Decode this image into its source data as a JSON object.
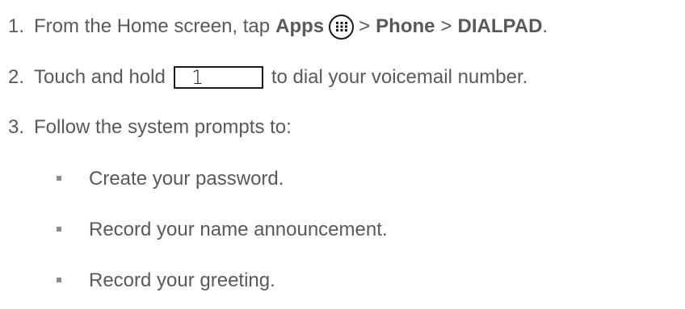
{
  "steps": [
    {
      "number": "1.",
      "pre": "From the Home screen, tap",
      "apps": "Apps",
      "sep1": ">",
      "phone": "Phone",
      "sep2": ">",
      "dialpad": "DIALPAD",
      "end": "."
    },
    {
      "number": "2.",
      "pre": "Touch and hold",
      "key": "1",
      "post": "to dial your voicemail number."
    },
    {
      "number": "3.",
      "text": "Follow the system prompts to:"
    }
  ],
  "subitems": [
    "Create your password.",
    "Record your name announcement.",
    "Record your greeting."
  ],
  "icons": {
    "apps": "apps-grid-icon",
    "bullet": "square-bullet-icon"
  },
  "colors": {
    "text": "#595959",
    "icon": "#1a1a1a",
    "bullet": "#8c8c8c"
  }
}
